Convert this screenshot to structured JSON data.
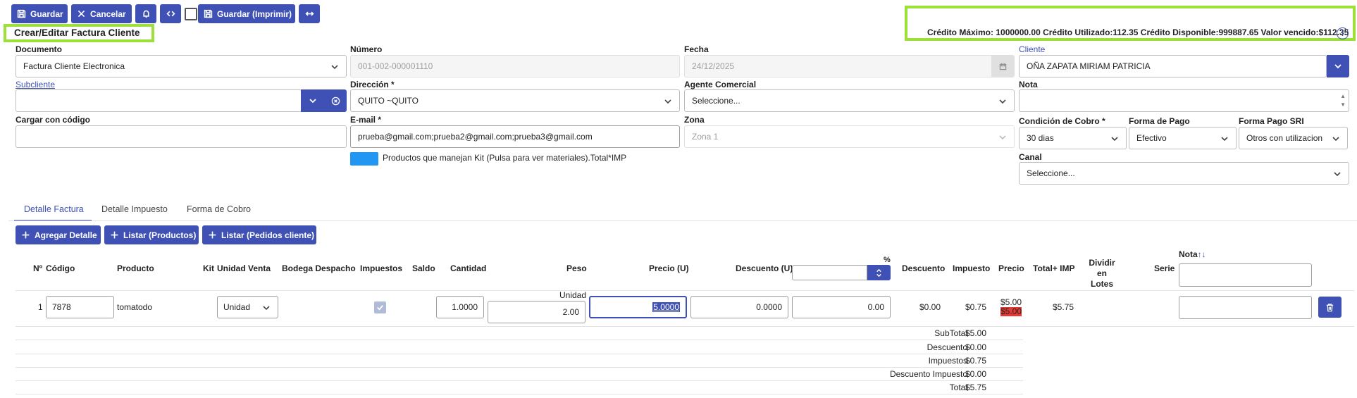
{
  "toolbar": {
    "save": "Guardar",
    "cancel": "Cancelar",
    "save_print": "Guardar (Imprimir)"
  },
  "page_title": "Crear/Editar Factura Cliente",
  "credit": {
    "text": "Crédito Máximo: 1000000.00 Crédito Utilizado:112.35 Crédito Disponible:999887.65 Valor vencido:$112.35"
  },
  "form": {
    "documento": {
      "label": "Documento",
      "value": "Factura Cliente Electronica"
    },
    "numero": {
      "label": "Número",
      "value": "001-002-000001110"
    },
    "fecha": {
      "label": "Fecha",
      "value": "24/12/2025"
    },
    "cliente": {
      "label": "Cliente",
      "value": "OÑA ZAPATA MIRIAM PATRICIA"
    },
    "subcliente": {
      "label": "Subcliente",
      "value": ""
    },
    "direccion": {
      "label": "Dirección",
      "value": "QUITO ~QUITO"
    },
    "agente": {
      "label": "Agente Comercial",
      "value": "Seleccione..."
    },
    "nota": {
      "label": "Nota",
      "value": ""
    },
    "cargar": {
      "label": "Cargar con código",
      "value": ""
    },
    "email": {
      "label": "E-mail",
      "value": "prueba@gmail.com;prueba2@gmail.com;prueba3@gmail.com"
    },
    "zona": {
      "label": "Zona",
      "value": "Zona 1"
    },
    "condicion": {
      "label": "Condición de Cobro",
      "value": "30 dias"
    },
    "forma_pago": {
      "label": "Forma de Pago",
      "value": "Efectivo"
    },
    "forma_pago_sri": {
      "label": "Forma Pago SRI",
      "value": "Otros con utilizacion"
    },
    "canal": {
      "label": "Canal",
      "value": "Seleccione..."
    },
    "required_mark": "*",
    "kit_note": "Productos que manejan Kit (Pulsa para ver materiales).Total*IMP",
    "kit_color": "#2196f3"
  },
  "tabs": [
    "Detalle Factura",
    "Detalle Impuesto",
    "Forma de Cobro"
  ],
  "detail_buttons": {
    "add": "Agregar Detalle",
    "list_products": "Listar (Productos)",
    "list_orders": "Listar (Pedidos cliente)"
  },
  "table": {
    "headers": {
      "num": "Nº",
      "codigo": "Código",
      "producto": "Producto",
      "kit": "Kit",
      "unidad_venta": "Unidad Venta",
      "bodega": "Bodega Despacho",
      "impuestos": "Impuestos",
      "saldo": "Saldo",
      "cantidad": "Cantidad",
      "peso": "Peso",
      "precio_u": "Precio (U)",
      "descuento_u": "Descuento (U)",
      "pct": "%",
      "descuento": "Descuento",
      "impuesto": "Impuesto",
      "precio": "Precio",
      "total_imp": "Total+ IMP",
      "dividir_1": "Dividir en",
      "dividir_2": "Lotes",
      "serie": "Serie",
      "nota": "Nota",
      "sort_icon": "↑↓"
    },
    "rows": [
      {
        "num": "1",
        "codigo": "7878",
        "producto": "tomatodo",
        "unidad": "Unidad",
        "peso_unit": "Unidad",
        "cantidad": "1.0000",
        "peso": "2.00",
        "precio_u": "5.0000",
        "descuento_u": "0.0000",
        "descuento_pct": "0.00",
        "descuento": "$0.00",
        "impuesto": "$0.75",
        "precio_1": "$5.00",
        "precio_2": "$5.00",
        "total_imp": "$5.75"
      }
    ]
  },
  "totals": [
    {
      "label": "SubTotal",
      "value": "$5.00"
    },
    {
      "label": "Descuento",
      "value": "$0.00"
    },
    {
      "label": "Impuestos",
      "value": "$0.75"
    },
    {
      "label": "Descuento Impuesto",
      "value": "$0.00"
    },
    {
      "label": "Total",
      "value": "$5.75"
    }
  ],
  "colors": {
    "primary": "#3f51b5",
    "highlight": "#9ee03a",
    "price_alert": "#e53935"
  }
}
